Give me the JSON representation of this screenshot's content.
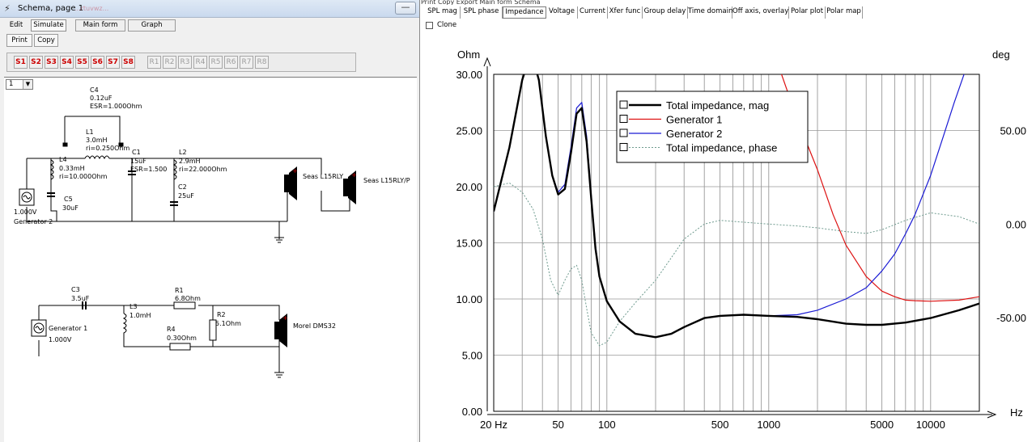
{
  "schema_window": {
    "title": "Schema, page 1",
    "ghost_title": "...rtuvwz...",
    "menu": {
      "edit": "Edit",
      "simulate": "Simulate",
      "main_form": "Main form",
      "graph": "Graph"
    },
    "toolbar": {
      "print": "Print",
      "copy": "Copy"
    },
    "s_buttons": [
      "S1",
      "S2",
      "S3",
      "S4",
      "S5",
      "S6",
      "S7",
      "S8"
    ],
    "r_buttons": [
      "R1",
      "R2",
      "R3",
      "R4",
      "R5",
      "R6",
      "R7",
      "R8"
    ],
    "page_select": {
      "value": "1",
      "arrow": "▼"
    },
    "app_icon": "circuit-icon",
    "min_glyph": "—",
    "circuit_top": {
      "c4": "C4",
      "c4_val": "0.12uF",
      "c4_esr": "ESR=1.000Ohm",
      "l1": "L1",
      "l1_val": "3.0mH",
      "l1_ri": "ri=0.250Ohm",
      "c1": "C1",
      "c1_val": "15uF",
      "c1_esr": "ESR=1.500",
      "l2": "L2",
      "l2_val": "2.9mH",
      "l2_ri": "ri=22.000Ohm",
      "l4": "L4",
      "l4_val": "0.33mH",
      "l4_ri": "ri=10.000Ohm",
      "c2": "C2",
      "c2_val": "25uF",
      "c5": "C5",
      "c5_val": "30uF",
      "gen_voltage": "1.000V",
      "gen_name": "Generator 2",
      "spk1": "Seas L15RLY",
      "spk2": "Seas L15RLY/P"
    },
    "circuit_bottom": {
      "c3": "C3",
      "c3_val": "3.5uF",
      "l3": "L3",
      "l3_val": "1.0mH",
      "r1": "R1",
      "r1_val": "6.8Ohm",
      "r2": "R2",
      "r2_val": "5.1Ohm",
      "r4": "R4",
      "r4_val": "0.30Ohm",
      "gen_name": "Generator 1",
      "gen_voltage": "1.000V",
      "spk": "Morel DMS32"
    }
  },
  "chart_panel": {
    "top_menu": "Print    Copy    Export    Main form    Schema",
    "tabs": [
      "SPL mag",
      "SPL phase",
      "Impedance",
      "Voltage",
      "Current",
      "Xfer func",
      "Group delay",
      "Time domain",
      "Off axis, overlay",
      "Polar plot",
      "Polar map"
    ],
    "active_tab": "Impedance",
    "clone_label": "Clone"
  },
  "chart_data": {
    "type": "line",
    "xlabel": "Hz",
    "ylabel": "Ohm",
    "y2label": "deg",
    "x_scale": "log",
    "xlim": [
      20,
      20000
    ],
    "ylim": [
      0,
      30
    ],
    "y2lim": [
      -100,
      80
    ],
    "x_ticks": [
      "20 Hz",
      "50",
      "100",
      "500",
      "1000",
      "5000",
      "10000"
    ],
    "x_tick_values": [
      20,
      50,
      100,
      500,
      1000,
      5000,
      10000
    ],
    "y_ticks": [
      "0.00",
      "5.00",
      "10.00",
      "15.00",
      "20.00",
      "25.00",
      "30.00"
    ],
    "y_tick_values": [
      0,
      5,
      10,
      15,
      20,
      25,
      30
    ],
    "y2_ticks": [
      "-50.00",
      "0.00",
      "50.00"
    ],
    "y2_tick_values": [
      -50,
      0,
      50
    ],
    "grid": true,
    "legend_position": "top-center",
    "colors": {
      "total_mag": "#000000",
      "gen1": "#dd1111",
      "gen2": "#1a1ad4",
      "phase": "#6e9a8e"
    },
    "series": [
      {
        "name": "Total impedance, mag",
        "axis": "left",
        "x": [
          20,
          25,
          30,
          34,
          38,
          42,
          46,
          50,
          55,
          60,
          65,
          70,
          75,
          80,
          85,
          90,
          100,
          120,
          150,
          200,
          250,
          300,
          400,
          500,
          700,
          1000,
          1500,
          2000,
          3000,
          4000,
          5000,
          7000,
          10000,
          15000,
          20000
        ],
        "y": [
          17.8,
          23.5,
          29.5,
          32,
          29.5,
          24.5,
          21,
          19.3,
          19.8,
          23,
          26.5,
          27,
          24,
          19,
          14.5,
          12,
          9.8,
          8,
          6.9,
          6.6,
          6.9,
          7.5,
          8.3,
          8.5,
          8.6,
          8.5,
          8.4,
          8.2,
          7.8,
          7.7,
          7.7,
          7.9,
          8.3,
          9,
          9.6
        ]
      },
      {
        "name": "Generator 1",
        "axis": "left",
        "x": [
          1000,
          1200,
          1500,
          2000,
          2500,
          3000,
          4000,
          5000,
          6000,
          7000,
          8000,
          10000,
          15000,
          20000
        ],
        "y": [
          34,
          30,
          26,
          21.5,
          17.5,
          14.8,
          12,
          10.7,
          10.2,
          9.9,
          9.85,
          9.8,
          9.9,
          10.2
        ]
      },
      {
        "name": "Generator 2",
        "axis": "left",
        "x": [
          20,
          25,
          30,
          34,
          38,
          42,
          46,
          50,
          55,
          60,
          65,
          70,
          75,
          80,
          85,
          90,
          100,
          120,
          150,
          200,
          250,
          300,
          400,
          500,
          700,
          1000,
          1500,
          2000,
          3000,
          4000,
          5000,
          6000,
          7000,
          8000,
          10000,
          12000,
          14000,
          17000
        ],
        "y": [
          17.8,
          23.5,
          29.5,
          32,
          29.5,
          24.5,
          21,
          19.5,
          20.2,
          23.5,
          27,
          27.5,
          24.5,
          19.3,
          14.8,
          12,
          9.8,
          8,
          6.9,
          6.6,
          6.9,
          7.5,
          8.3,
          8.5,
          8.6,
          8.5,
          8.6,
          9,
          10,
          11,
          12.5,
          14,
          15.8,
          17.5,
          21,
          24.5,
          27.5,
          31
        ]
      },
      {
        "name": "Total impedance, phase",
        "axis": "right",
        "x": [
          20,
          25,
          30,
          35,
          40,
          45,
          50,
          55,
          60,
          65,
          70,
          75,
          80,
          90,
          100,
          120,
          150,
          200,
          250,
          300,
          400,
          500,
          700,
          1000,
          1500,
          2000,
          3000,
          4000,
          5000,
          7000,
          10000,
          15000,
          20000
        ],
        "y": [
          20,
          22,
          17,
          8,
          -8,
          -30,
          -38,
          -30,
          -24,
          -22,
          -30,
          -45,
          -58,
          -65,
          -63,
          -52,
          -42,
          -30,
          -18,
          -8,
          0,
          2,
          1,
          0,
          -1,
          -2,
          -4,
          -5,
          -3,
          2,
          6,
          4,
          0
        ]
      }
    ]
  }
}
